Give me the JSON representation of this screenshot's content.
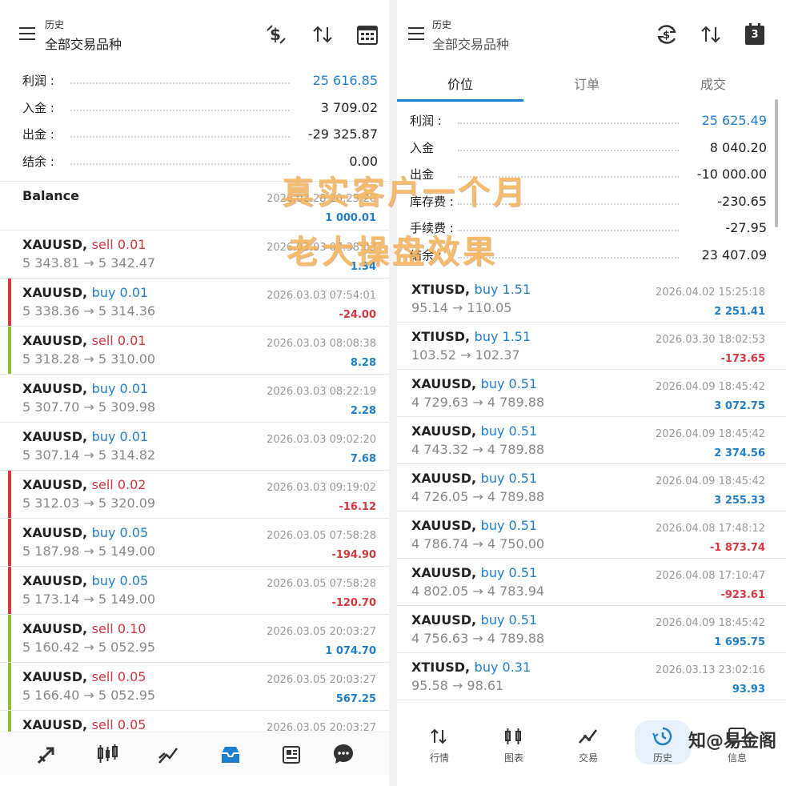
{
  "left": {
    "header": {
      "title": "历史",
      "subtitle": "全部交易品种",
      "icons": [
        "dollar-swap-icon",
        "sort-icon",
        "calendar-icon"
      ]
    },
    "summary": [
      {
        "label": "利润 :",
        "value": "25 616.85",
        "highlight": true
      },
      {
        "label": "入金 :",
        "value": "3 709.02",
        "highlight": false
      },
      {
        "label": "出金 :",
        "value": "-29 325.87",
        "highlight": false
      },
      {
        "label": "结余 :",
        "value": "0.00",
        "highlight": false
      }
    ],
    "balance": {
      "label": "Balance",
      "date": "2026.02.28 20:25:20",
      "value": "1 000.01"
    },
    "trades": [
      {
        "symbol": "XAUUSD,",
        "dir": "sell",
        "lot": "sell 0.01",
        "prices": "5 343.81 → 5 342.47",
        "date": "2026.03.03 07:38:03",
        "profit": "1.34",
        "bar": "none"
      },
      {
        "symbol": "XAUUSD,",
        "dir": "buy",
        "lot": "buy 0.01",
        "prices": "5 338.36 → 5 314.36",
        "date": "2026.03.03 07:54:01",
        "profit": "-24.00",
        "bar": "red"
      },
      {
        "symbol": "XAUUSD,",
        "dir": "sell",
        "lot": "sell 0.01",
        "prices": "5 318.28 → 5 310.00",
        "date": "2026.03.03 08:08:38",
        "profit": "8.28",
        "bar": "green"
      },
      {
        "symbol": "XAUUSD,",
        "dir": "buy",
        "lot": "buy 0.01",
        "prices": "5 307.70 → 5 309.98",
        "date": "2026.03.03 08:22:19",
        "profit": "2.28",
        "bar": "none"
      },
      {
        "symbol": "XAUUSD,",
        "dir": "buy",
        "lot": "buy 0.01",
        "prices": "5 307.14 → 5 314.82",
        "date": "2026.03.03 09:02:20",
        "profit": "7.68",
        "bar": "none"
      },
      {
        "symbol": "XAUUSD,",
        "dir": "sell",
        "lot": "sell 0.02",
        "prices": "5 312.03 → 5 320.09",
        "date": "2026.03.03 09:19:02",
        "profit": "-16.12",
        "bar": "red"
      },
      {
        "symbol": "XAUUSD,",
        "dir": "buy",
        "lot": "buy 0.05",
        "prices": "5 187.98 → 5 149.00",
        "date": "2026.03.05 07:58:28",
        "profit": "-194.90",
        "bar": "red"
      },
      {
        "symbol": "XAUUSD,",
        "dir": "buy",
        "lot": "buy 0.05",
        "prices": "5 173.14 → 5 149.00",
        "date": "2026.03.05 07:58:28",
        "profit": "-120.70",
        "bar": "red"
      },
      {
        "symbol": "XAUUSD,",
        "dir": "sell",
        "lot": "sell 0.10",
        "prices": "5 160.42 → 5 052.95",
        "date": "2026.03.05 20:03:27",
        "profit": "1 074.70",
        "bar": "green"
      },
      {
        "symbol": "XAUUSD,",
        "dir": "sell",
        "lot": "sell 0.05",
        "prices": "5 166.40 → 5 052.95",
        "date": "2026.03.05 20:03:27",
        "profit": "567.25",
        "bar": "green"
      },
      {
        "symbol": "XAUUSD,",
        "dir": "sell",
        "lot": "sell 0.05",
        "prices": "",
        "date": "2026.03.05 20:03:27",
        "profit": "",
        "bar": "green"
      }
    ],
    "nav": [
      "trade-icon",
      "chart-icon",
      "trend-icon",
      "inbox-icon",
      "news-icon",
      "chat-icon"
    ]
  },
  "right": {
    "header": {
      "title": "历史",
      "subtitle": "全部交易品种",
      "calendar_badge": "3",
      "icons": [
        "refresh-dollar-icon",
        "sort-icon",
        "calendar-icon"
      ]
    },
    "tabs": [
      {
        "label": "价位",
        "active": true
      },
      {
        "label": "订单",
        "active": false
      },
      {
        "label": "成交",
        "active": false
      }
    ],
    "summary": [
      {
        "label": "利润 :",
        "value": "25 625.49",
        "highlight": true
      },
      {
        "label": "入金",
        "value": "8 040.20",
        "highlight": false
      },
      {
        "label": "出金",
        "value": "-10 000.00",
        "highlight": false
      },
      {
        "label": "库存费 :",
        "value": "-230.65",
        "highlight": false
      },
      {
        "label": "手续费 :",
        "value": "-27.95",
        "highlight": false
      },
      {
        "label": "结余 :",
        "value": "23 407.09",
        "highlight": false
      }
    ],
    "trades": [
      {
        "symbol": "XTIUSD,",
        "dir": "buy",
        "lot": "buy 1.51",
        "prices": "95.14 → 110.05",
        "date": "2026.04.02 15:25:18",
        "profit": "2 251.41"
      },
      {
        "symbol": "XTIUSD,",
        "dir": "buy",
        "lot": "buy 1.51",
        "prices": "103.52 → 102.37",
        "date": "2026.03.30 18:02:53",
        "profit": "-173.65"
      },
      {
        "symbol": "XAUUSD,",
        "dir": "buy",
        "lot": "buy 0.51",
        "prices": "4 729.63 → 4 789.88",
        "date": "2026.04.09 18:45:42",
        "profit": "3 072.75"
      },
      {
        "symbol": "XAUUSD,",
        "dir": "buy",
        "lot": "buy 0.51",
        "prices": "4 743.32 → 4 789.88",
        "date": "2026.04.09 18:45:42",
        "profit": "2 374.56"
      },
      {
        "symbol": "XAUUSD,",
        "dir": "buy",
        "lot": "buy 0.51",
        "prices": "4 726.05 → 4 789.88",
        "date": "2026.04.09 18:45:42",
        "profit": "3 255.33"
      },
      {
        "symbol": "XAUUSD,",
        "dir": "buy",
        "lot": "buy 0.51",
        "prices": "4 786.74 → 4 750.00",
        "date": "2026.04.08 17:48:12",
        "profit": "-1 873.74"
      },
      {
        "symbol": "XAUUSD,",
        "dir": "buy",
        "lot": "buy 0.51",
        "prices": "4 802.05 → 4 783.94",
        "date": "2026.04.08 17:10:47",
        "profit": "-923.61"
      },
      {
        "symbol": "XAUUSD,",
        "dir": "buy",
        "lot": "buy 0.51",
        "prices": "4 756.63 → 4 789.88",
        "date": "2026.04.09 18:45:42",
        "profit": "1 695.75"
      },
      {
        "symbol": "XTIUSD,",
        "dir": "buy",
        "lot": "buy 0.31",
        "prices": "95.58 → 98.61",
        "date": "2026.03.13 23:02:16",
        "profit": "93.93"
      }
    ],
    "nav": [
      {
        "label": "行情",
        "icon": "arrows-updown-icon"
      },
      {
        "label": "图表",
        "icon": "candlestick-icon"
      },
      {
        "label": "交易",
        "icon": "trend-icon"
      },
      {
        "label": "历史",
        "icon": "history-icon"
      },
      {
        "label": "信息",
        "icon": "message-icon"
      }
    ]
  },
  "overlay": {
    "line1": "真实客户一个月",
    "line2": "老大操盘效果"
  },
  "watermark": "知@易金阁",
  "colors": {
    "blue": "#1e7fd0",
    "red": "#d9363e",
    "green": "#8bbf2c",
    "overlay": "#f5b55e"
  }
}
